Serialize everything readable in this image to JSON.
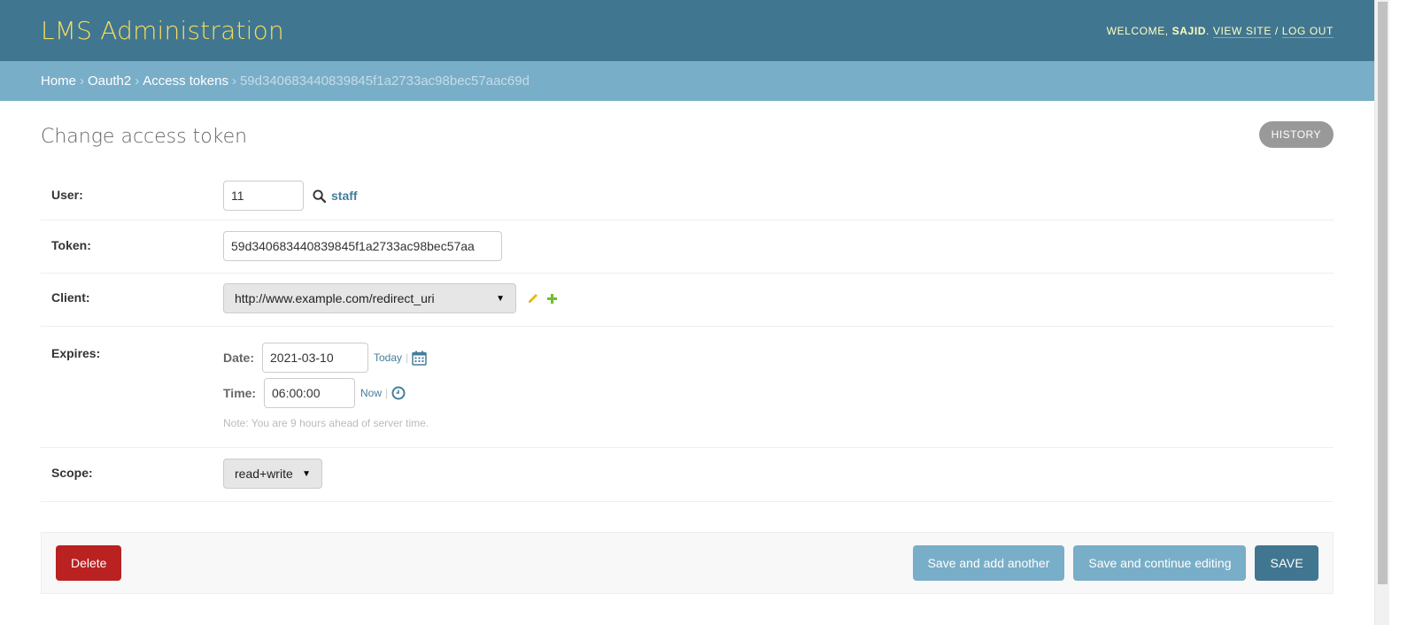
{
  "header": {
    "branding": "LMS Administration",
    "welcome_prefix": "WELCOME,",
    "username": "SAJID",
    "welcome_suffix": ".",
    "view_site": "VIEW SITE",
    "separator": "/",
    "log_out": "LOG OUT"
  },
  "breadcrumbs": {
    "items": [
      "Home",
      "Oauth2",
      "Access tokens"
    ],
    "separator": "›",
    "current": "59d340683440839845f1a2733ac98bec57aac69d"
  },
  "page": {
    "title": "Change access token",
    "history_label": "HISTORY"
  },
  "form": {
    "user": {
      "label": "User:",
      "value": "11",
      "lookup_text": "staff"
    },
    "token": {
      "label": "Token:",
      "value": "59d340683440839845f1a2733ac98bec57aa"
    },
    "client": {
      "label": "Client:",
      "selected": "http://www.example.com/redirect_uri"
    },
    "expires": {
      "label": "Expires:",
      "date_label": "Date:",
      "date_value": "2021-03-10",
      "today_link": "Today",
      "time_label": "Time:",
      "time_value": "06:00:00",
      "now_link": "Now",
      "pipe": "|",
      "note": "Note: You are 9 hours ahead of server time."
    },
    "scope": {
      "label": "Scope:",
      "selected": "read+write"
    }
  },
  "actions": {
    "delete": "Delete",
    "save_add_another": "Save and add another",
    "save_continue": "Save and continue editing",
    "save": "SAVE"
  },
  "colors": {
    "header_bg": "#417690",
    "breadcrumb_bg": "#79aec8",
    "branding": "#f5dd5d",
    "delete": "#ba2121",
    "link": "#447e9b"
  },
  "icons": {
    "lookup": "search-icon",
    "edit": "pencil-icon",
    "add": "plus-icon",
    "calendar": "calendar-icon",
    "clock": "clock-icon"
  }
}
